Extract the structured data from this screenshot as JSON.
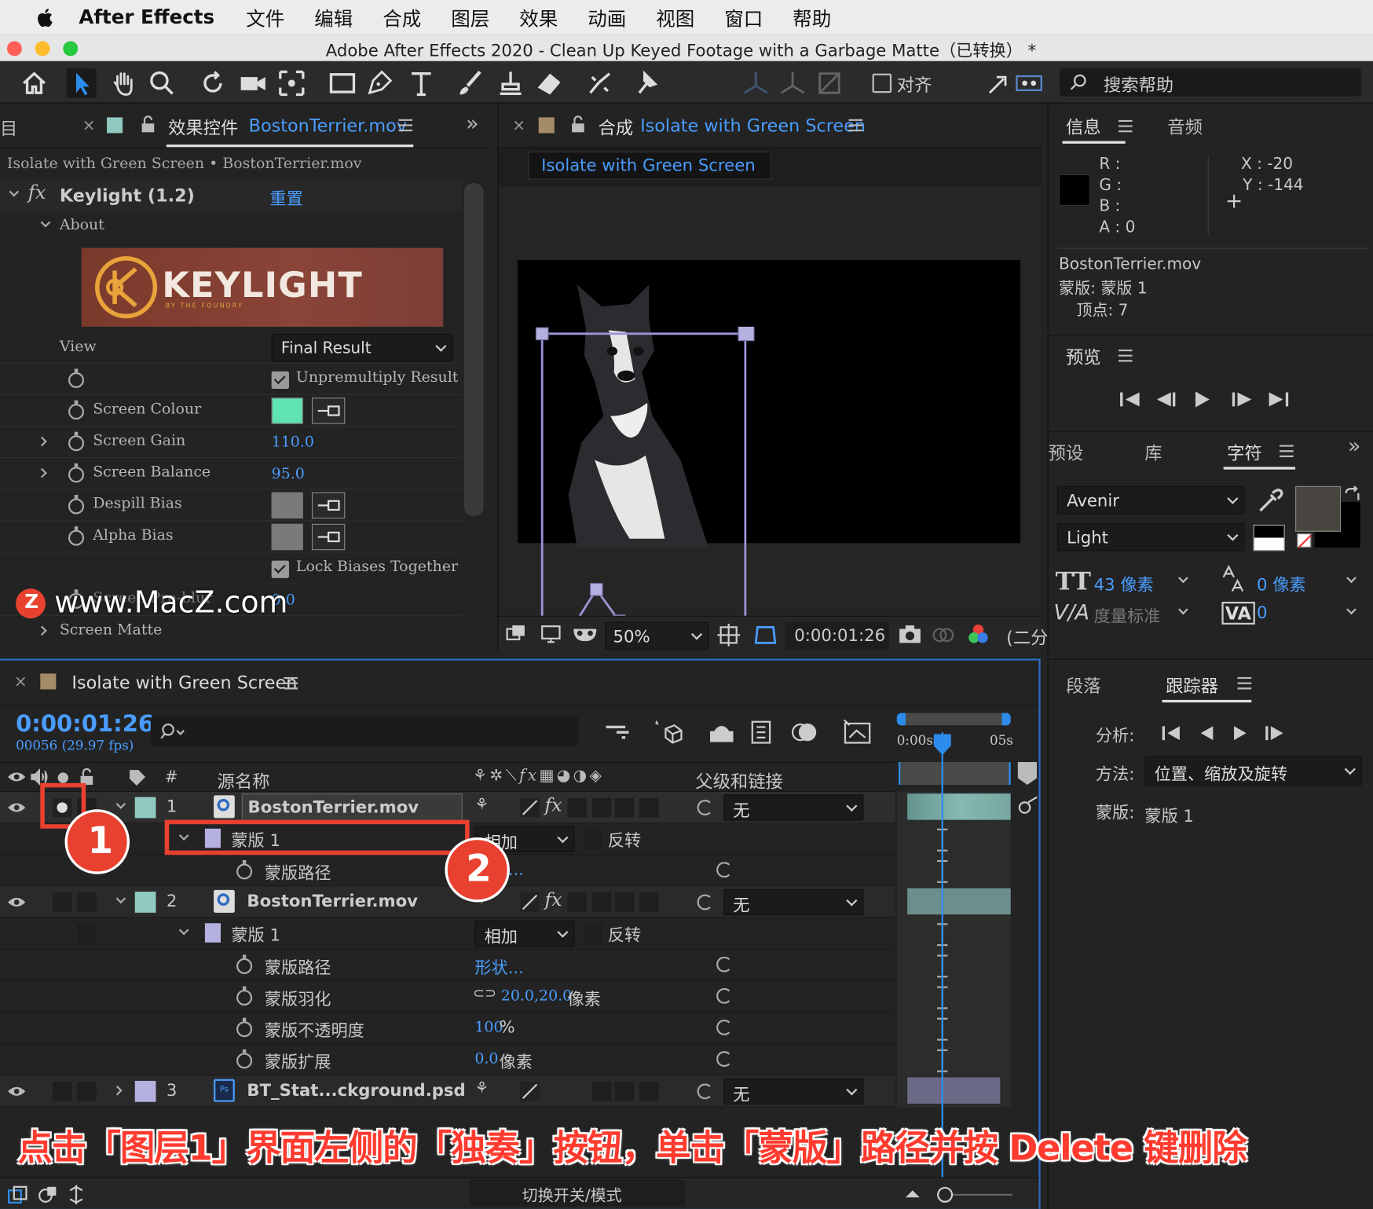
{
  "menubar": {
    "app": "After Effects",
    "items": [
      "文件",
      "编辑",
      "合成",
      "图层",
      "效果",
      "动画",
      "视图",
      "窗口",
      "帮助"
    ]
  },
  "window": {
    "title": "Adobe After Effects 2020 - Clean Up Keyed Footage with a Garbage Matte（已转换） *"
  },
  "toolbar": {
    "align_label": "对齐",
    "search_placeholder": "搜索帮助"
  },
  "effects_panel": {
    "left_tab": "目",
    "tab_prefix": "效果控件",
    "tab_file": "BostonTerrier.mov",
    "breadcrumb": "Isolate with Green Screen • BostonTerrier.mov",
    "effect_name": "Keylight (1.2)",
    "reset": "重置",
    "about": "About",
    "logo_text": "KEYLIGHT",
    "logo_sub": "BY THE FOUNDRY",
    "view_label": "View",
    "view_value": "Final Result",
    "unpremultiply": "Unpremultiply Result",
    "screen_colour": "Screen Colour",
    "screen_colour_hex": "#5fe3b0",
    "screen_gain": "Screen Gain",
    "screen_gain_value": "110.0",
    "screen_balance": "Screen Balance",
    "screen_balance_value": "95.0",
    "despill_bias": "Despill Bias",
    "alpha_bias": "Alpha Bias",
    "lock_biases": "Lock Biases Together",
    "screen_pre_blur": "Screen Pre-blur",
    "screen_pre_blur_value": "0.0",
    "screen_matte": "Screen Matte"
  },
  "watermark": {
    "text": "www.MacZ.com"
  },
  "comp_panel": {
    "tab_prefix": "合成",
    "tab_name": "Isolate with Green Screen",
    "comp_tab": "Isolate with Green Screen",
    "zoom": "50%",
    "timecode": "0:00:01:26",
    "res": "(二分"
  },
  "info_panel": {
    "tab_info": "信息",
    "tab_audio": "音频",
    "r": "R :",
    "g": "G :",
    "b": "B :",
    "a": "A :  0",
    "x": "X : -20",
    "y": "Y :  -144",
    "file": "BostonTerrier.mov",
    "mask": "蒙版: 蒙版 1",
    "vertex": "顶点: 7"
  },
  "preview_panel": {
    "title": "预览"
  },
  "char_panel": {
    "tab_presets": "预设",
    "tab_library": "库",
    "tab_char": "字符",
    "font": "Avenir",
    "style": "Light",
    "size": "43 像素",
    "leading": "0 像素",
    "kerning": "度量标准",
    "tracking": "0"
  },
  "tracker_panel": {
    "tab_para": "段落",
    "tab_tracker": "跟踪器",
    "analyze": "分析:",
    "method_label": "方法:",
    "method_value": "位置、缩放及旋转",
    "mask_label": "蒙版:",
    "mask_value": "蒙版 1"
  },
  "timeline": {
    "tab": "Isolate with Green Screen",
    "timecode": "0:00:01:26",
    "frames": "00056 (29.97 fps)",
    "col_hash": "#",
    "col_source": "源名称",
    "col_parent": "父级和链接",
    "ruler_start": "0:00s",
    "ruler_end": "05s",
    "footer": "切换开关/模式",
    "layers": [
      {
        "num": "1",
        "name": "BostonTerrier.mov",
        "parent": "无"
      },
      {
        "mask": "蒙版 1",
        "mode": "相加",
        "invert": "反转"
      },
      {
        "prop": "蒙版路径",
        "value": "..."
      },
      {
        "num": "2",
        "name": "BostonTerrier.mov",
        "parent": "无"
      },
      {
        "mask": "蒙版 1",
        "mode": "相加",
        "invert": "反转"
      },
      {
        "prop": "蒙版路径",
        "value": "形状..."
      },
      {
        "prop": "蒙版羽化",
        "value": "20.0,20.0",
        "unit": "像素"
      },
      {
        "prop": "蒙版不透明度",
        "value": "100",
        "unit": "%"
      },
      {
        "prop": "蒙版扩展",
        "value": "0.0",
        "unit": "像素"
      },
      {
        "num": "3",
        "name": "BT_Stat...ckground.psd",
        "parent": "无"
      }
    ]
  },
  "annotations": {
    "badge1": "1",
    "badge2": "2",
    "caption": "点击「图层1」界面左侧的「独奏」按钮，单击「蒙版」路径并按 Delete 键删除"
  },
  "colors": {
    "accent_blue": "#4a9dff",
    "highlight_red": "#e8412f",
    "caption_red": "#ff3b2f",
    "layer_teal": "#8fc9c0",
    "mask_lavender": "#b4b0e0"
  }
}
